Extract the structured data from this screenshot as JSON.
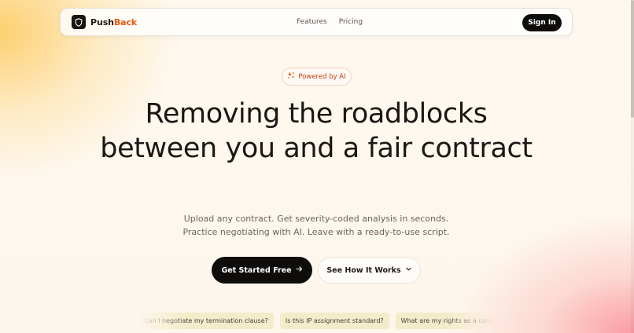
{
  "brand": {
    "name_part1": "Push",
    "name_part2": "Back"
  },
  "nav": {
    "links": [
      "Features",
      "Pricing"
    ],
    "signin_label": "Sign In"
  },
  "badge": {
    "label": "Powered by AI"
  },
  "hero": {
    "title": "Removing the roadblocks between you and a fair contract",
    "subtitle_line1": "Upload any contract. Get severity-coded analysis in seconds.",
    "subtitle_line2": "Practice negotiating with AI. Leave with a ready-to-use script."
  },
  "cta": {
    "primary": "Get Started Free",
    "secondary": "See How It Works"
  },
  "chips": [
    "Can I negotiate my termination clause?",
    "Is this IP assignment standard?",
    "What are my rights as a contractor?"
  ],
  "colors": {
    "accent": "#ea580c",
    "dark": "#0f0d0b",
    "chip_bg": "#f3ecc8",
    "background": "#fdf8f1"
  }
}
